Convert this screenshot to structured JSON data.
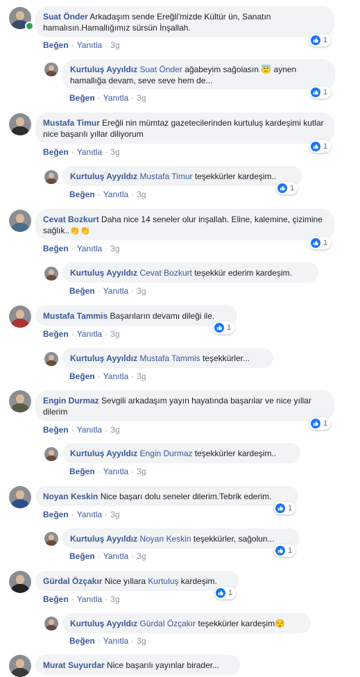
{
  "actions": {
    "like": "Beğen",
    "reply": "Yanıtla",
    "sep": "·"
  },
  "comments": [
    {
      "author": "Suat Önder",
      "text": "Arkadaşım sende Ereğli'mizde Kültür ün, Sanatın hamalısın.Hamallığımız sürsün İnşallah.",
      "time": "3g",
      "likes": "1",
      "reply": {
        "author": "Kurtuluş Ayyıldız",
        "mention": "Suat Önder",
        "text": "ağabeyim sağolasın 😇 aynen hamallığa devam, seve seve hem de...",
        "time": "3g",
        "likes": "1"
      }
    },
    {
      "author": "Mustafa Timur",
      "text": "Ereğli nin mümtaz gazetecilerinden kurtuluş kardeşimi kutlar nice başarılı yıllar diliyorum",
      "time": "3g",
      "likes": "1",
      "reply": {
        "author": "Kurtuluş Ayyıldız",
        "mention": "Mustafa Timur",
        "text": "teşekkürler kardeşim..",
        "time": "3g",
        "likes": "1"
      }
    },
    {
      "author": "Cevat Bozkurt",
      "text": "Daha nice 14 seneler olur inşallah. Eline, kalemine, çizimine sağlık..👏👏",
      "time": "3g",
      "likes": "1",
      "reply": {
        "author": "Kurtuluş Ayyıldız",
        "mention": "Cevat Bozkurt",
        "text": "teşekkür ederim kardeşim.",
        "time": "3g",
        "likes": ""
      }
    },
    {
      "author": "Mustafa Tammis",
      "text": "Başarıların devamı dileği ile.",
      "time": "3g",
      "likes": "1",
      "reply": {
        "author": "Kurtuluş Ayyıldız",
        "mention": "Mustafa Tammis",
        "text": "teşekkürler...",
        "time": "3g",
        "likes": ""
      }
    },
    {
      "author": "Engin Durmaz",
      "text": "Sevgili arkadaşım yayın hayatında başarılar ve nice yıllar dilerim",
      "time": "3g",
      "likes": "1",
      "reply": {
        "author": "Kurtuluş Ayyıldız",
        "mention": "Engin Durmaz",
        "text": "teşekkürler kardeşim..",
        "time": "3g",
        "likes": ""
      }
    },
    {
      "author": "Noyan Keskin",
      "text": "Nice başarı dolu seneler dilerim.Tebrik ederim.",
      "time": "3g",
      "likes": "1",
      "reply": {
        "author": "Kurtuluş Ayyıldız",
        "mention": "Noyan Keskin",
        "text": "teşekkürler, sağolun...",
        "time": "3g",
        "likes": "1"
      }
    },
    {
      "author": "Gürdal Özçakır",
      "text": "Nice yıllara",
      "text_mention": "Kurtuluş",
      "text_tail": "kardeşim.",
      "time": "3g",
      "likes": "1",
      "reply": {
        "author": "Kurtuluş Ayyıldız",
        "mention": "Gürdal Özçakır",
        "text": "teşekkürler kardeşim😌",
        "time": "3g",
        "likes": ""
      }
    },
    {
      "author": "Murat Suyurdar",
      "text": "Nice başarılı yayınlar birader..."
    }
  ]
}
